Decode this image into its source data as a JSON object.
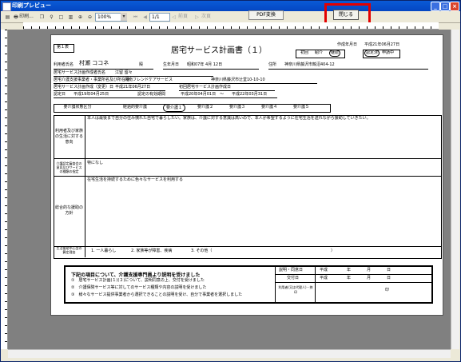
{
  "window": {
    "title": "印刷プレビュー"
  },
  "toolbar": {
    "print_label": "印刷...",
    "zoom_value": "100%",
    "page_value": "1/1",
    "prev_label": "前頁",
    "next_label": "次頁",
    "pdf_label": "PDF変換",
    "close_label": "閉じる"
  },
  "form": {
    "tab_label": "第１表",
    "title": "居宅サービス計画書（１）",
    "created_date_label": "作成年月日",
    "created_date": "平成21年06月27日",
    "status_options": [
      "初回",
      "紹介",
      "継続"
    ],
    "cert_options": [
      "認定済",
      "申請中"
    ],
    "user_name_label": "利用者氏名",
    "user_name": "村瀬 ココネ",
    "honorific": "殿",
    "birth_label": "生年月日",
    "birth_date": "昭和07年 4月 12日",
    "address_label": "住所",
    "address": "神奈川県藤沢市鵠沼404-12",
    "planner_label": "居宅サービス計画作成者氏名",
    "planner_name": "江留 留々",
    "office_label": "居宅介護支援事業者・事業所名及び所在地",
    "office_name": "湘南フレンドケアサービス",
    "office_address": "神奈川県藤沢市辻堂10-10-10",
    "change_date_label": "居宅サービス計画作成（変更）日",
    "change_date": "平成21年06月27日",
    "first_date_label": "初回居宅サービス計画作成日",
    "cert_date_label": "認定日",
    "cert_date": "平成19年04月25日",
    "valid_period_label": "認定の有効期間",
    "valid_from": "平成20年04月01日",
    "valid_tilde": "～",
    "valid_to": "平成22年03月31日",
    "care_level_label": "要介護状態区分",
    "care_levels": [
      "経過的要介護",
      "要介護１",
      "要介護２",
      "要介護３",
      "要介護４",
      "要介護５"
    ],
    "section1_label": "利用者及び家族の生活に対する意向",
    "section1_text": "本人は最後まで自分の住み慣れた自宅で暮らしたい。家族は、介護に対する意識は高いので、本人が希望するように在宅生活を送れながら援助していきたい。",
    "section2_label": "介護認定審査会の意見及びサービスの種類の指定",
    "section2_text": "特になし",
    "section3_label": "総合的な援助の方針",
    "section3_text": "在宅生活を持続するために色々なサービスを利用する",
    "section4_label": "生活援助中心型の算定理由",
    "section4_options": [
      "1. 一人暮らし",
      "2. 家族等が障害、疾病",
      "3. その他（"
    ],
    "section4_end": "）",
    "notice_title": "下記の項目について、介護支援専門員より説明を受けました",
    "notice_items": [
      "①　居宅サービス計画(１)(２)について、説明同意の上、交付を受けました",
      "②　介護保険サービス等に対してのサービス種類や内容の説明を受けました",
      "③　様々なサービス提供事業者から選択できることの説明を受け、自分で事業者を選択しました"
    ],
    "sign_rows": [
      {
        "label": "説明・同意日",
        "era": "平成",
        "y": "年",
        "m": "月",
        "d": "日"
      },
      {
        "label": "交付日",
        "era": "平成",
        "y": "年",
        "m": "月",
        "d": "日"
      }
    ],
    "signer_label": "利用者(又は代理人)・捺印",
    "seal_mark": "印"
  }
}
